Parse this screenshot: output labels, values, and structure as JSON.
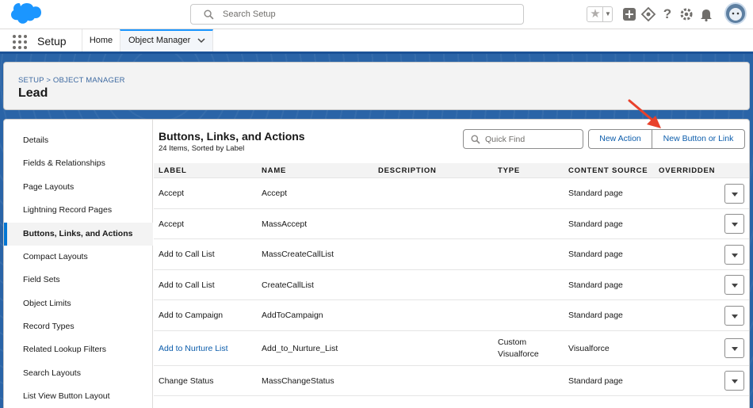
{
  "header": {
    "search_placeholder": "Search Setup",
    "icons": [
      "salesforce-logo",
      "favorites-star-icon",
      "chevron-down-icon",
      "add-icon",
      "trailhead-icon",
      "help-icon",
      "gear-icon",
      "bell-icon",
      "avatar"
    ]
  },
  "context_bar": {
    "app_name": "Setup",
    "tabs": [
      {
        "label": "Home"
      },
      {
        "label": "Object Manager"
      }
    ]
  },
  "page_header": {
    "breadcrumb": "SETUP > OBJECT MANAGER",
    "title": "Lead"
  },
  "left_nav": {
    "items": [
      {
        "label": "Details"
      },
      {
        "label": "Fields & Relationships"
      },
      {
        "label": "Page Layouts"
      },
      {
        "label": "Lightning Record Pages"
      },
      {
        "label": "Buttons, Links, and Actions",
        "active": true
      },
      {
        "label": "Compact Layouts"
      },
      {
        "label": "Field Sets"
      },
      {
        "label": "Object Limits"
      },
      {
        "label": "Record Types"
      },
      {
        "label": "Related Lookup Filters"
      },
      {
        "label": "Search Layouts"
      },
      {
        "label": "List View Button Layout"
      }
    ]
  },
  "content": {
    "title": "Buttons, Links, and Actions",
    "subtitle": "24 Items, Sorted by Label",
    "quickfind_placeholder": "Quick Find",
    "new_action_label": "New Action",
    "new_button_label": "New Button or Link",
    "columns": [
      "LABEL",
      "NAME",
      "DESCRIPTION",
      "TYPE",
      "CONTENT SOURCE",
      "OVERRIDDEN"
    ],
    "rows": [
      {
        "label": "Accept",
        "name": "Accept",
        "description": "",
        "type": "",
        "type2": "",
        "source": "Standard page"
      },
      {
        "label": "Accept",
        "name": "MassAccept",
        "description": "",
        "type": "",
        "type2": "",
        "source": "Standard page"
      },
      {
        "label": "Add to Call List",
        "name": "MassCreateCallList",
        "description": "",
        "type": "",
        "type2": "",
        "source": "Standard page"
      },
      {
        "label": "Add to Call List",
        "name": "CreateCallList",
        "description": "",
        "type": "",
        "type2": "",
        "source": "Standard page"
      },
      {
        "label": "Add to Campaign",
        "name": "AddToCampaign",
        "description": "",
        "type": "",
        "type2": "",
        "source": "Standard page"
      },
      {
        "label": "Add to Nurture List",
        "name": "Add_to_Nurture_List",
        "description": "",
        "type": "Custom",
        "type2": "Visualforce",
        "source": "Visualforce",
        "is_link": true
      },
      {
        "label": "Change Status",
        "name": "MassChangeStatus",
        "description": "",
        "type": "",
        "type2": "",
        "source": "Standard page"
      }
    ]
  },
  "colors": {
    "brand_blue": "#1b5297",
    "link_blue": "#0b5cab",
    "annotation_arrow": "#e8412b"
  }
}
